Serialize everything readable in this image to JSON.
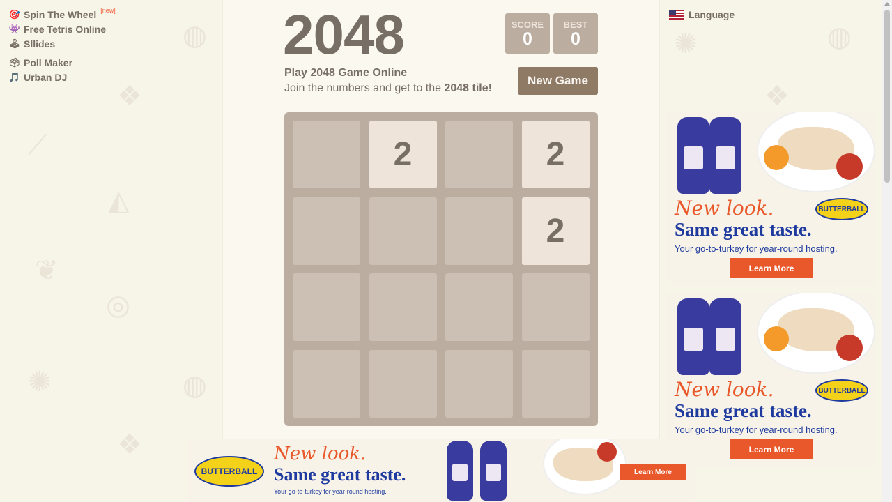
{
  "left_menu": [
    {
      "icon": "🎯",
      "label": "Spin The Wheel",
      "badge": "[new]"
    },
    {
      "icon": "👾",
      "label": "Free Tetris Online"
    },
    {
      "icon": "🕹",
      "label": "Sllides"
    },
    {
      "icon": "🗳",
      "label": "Poll Maker"
    },
    {
      "icon": "🎵",
      "label": "Urban DJ"
    }
  ],
  "language": {
    "label": "Language"
  },
  "game": {
    "title": "2048",
    "score": {
      "label": "SCORE",
      "value": "0"
    },
    "best": {
      "label": "BEST",
      "value": "0"
    },
    "intro_title": "Play 2048 Game Online",
    "intro_text_pre": "Join the numbers and get to the ",
    "intro_text_bold": "2048 tile!",
    "new_game_label": "New Game",
    "grid": [
      [
        "",
        "2",
        "",
        "2"
      ],
      [
        "",
        "",
        "",
        "2"
      ],
      [
        "",
        "",
        "",
        ""
      ],
      [
        "",
        "",
        "",
        ""
      ]
    ]
  },
  "ads": {
    "right_top": {
      "headline_a": "New look.",
      "headline_b": "Same great taste.",
      "sub": "Your go-to-turkey for year-round hosting.",
      "cta": "Learn More",
      "brand": "BUTTERBALL"
    },
    "right_bottom": {
      "headline_a": "New look.",
      "headline_b": "Same great taste.",
      "sub": "Your go-to-turkey for year-round hosting.",
      "cta": "Learn More",
      "brand": "BUTTERBALL"
    },
    "bottom_banner": {
      "headline_a": "New look.",
      "headline_b": "Same great taste.",
      "sub": "Your go-to-turkey for year-round hosting.",
      "cta": "Learn More",
      "brand": "BUTTERBALL"
    }
  },
  "colors": {
    "board": "#bbada0",
    "tile_2": "#eee4da",
    "button": "#8f7a66",
    "text": "#776e65",
    "ad_orange": "#e8582a",
    "ad_blue": "#1e3a9f"
  }
}
